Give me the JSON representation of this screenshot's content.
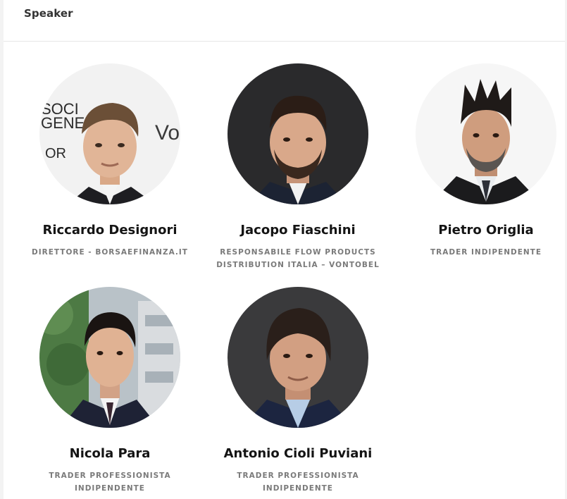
{
  "header": {
    "title": "Speaker"
  },
  "speakers": [
    {
      "name": "Riccardo Designori",
      "role_lines": [
        "DIRETTORE - BORSAEFINANZA.IT"
      ]
    },
    {
      "name": "Jacopo Fiaschini",
      "role_lines": [
        "RESPONSABILE FLOW PRODUCTS",
        "DISTRIBUTION ITALIA – VONTOBEL"
      ]
    },
    {
      "name": "Pietro Origlia",
      "role_lines": [
        "TRADER INDIPENDENTE"
      ]
    },
    {
      "name": "Nicola Para",
      "role_lines": [
        "TRADER PROFESSIONISTA",
        "INDIPENDENTE"
      ]
    },
    {
      "name": "Antonio Cioli Puviani",
      "role_lines": [
        "TRADER PROFESSIONISTA",
        "INDIPENDENTE"
      ]
    }
  ],
  "photo_backdrop": {
    "logo_text_lines": [
      "SOCI",
      "GENE",
      "OR",
      "Vo"
    ]
  },
  "colors": {
    "name_text": "#141414",
    "role_text": "#7a7a7a",
    "header_text": "#333333",
    "divider": "#e6e6e6"
  }
}
